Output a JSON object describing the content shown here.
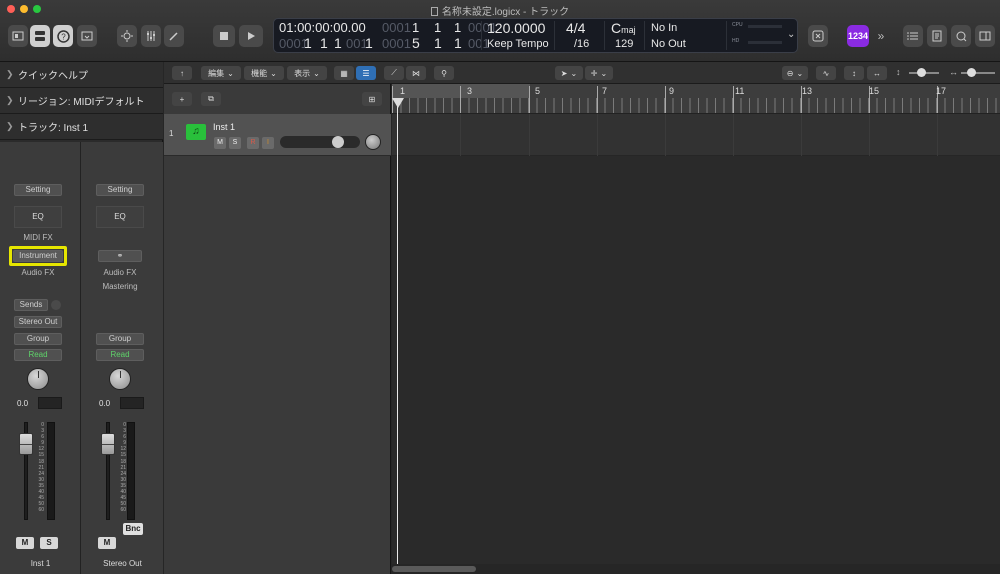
{
  "window": {
    "title": "名称未設定.logicx - トラック"
  },
  "lcd": {
    "position_time": "01:00:00:00.00",
    "position_time_dim": "0001",
    "position_bars": [
      "1",
      "1",
      "1"
    ],
    "position_bars_dim": [
      "0001"
    ],
    "position_bars2": [
      "1",
      "1",
      "1"
    ],
    "end_bars": [
      "5",
      "1",
      "1"
    ],
    "end_bars_dim": [
      "0001",
      "001"
    ],
    "tempo": "120.0000",
    "tempo_mode": "Keep Tempo",
    "signature_top": "4/4",
    "signature_bottom": "/16",
    "key": "C",
    "key_mode": "maj",
    "key_value": "129",
    "midi_in": "No In",
    "midi_out": "No Out",
    "cpu_label": "CPU",
    "hd_label": "HD"
  },
  "toolbar": {
    "count_in_badge": "1234"
  },
  "inspector": {
    "rows": [
      {
        "label": "クイックヘルプ"
      },
      {
        "label": "リージョン: MIDIデフォルト"
      },
      {
        "label": "トラック: Inst 1"
      }
    ],
    "strip1": {
      "setting": "Setting",
      "eq": "EQ",
      "midi_fx": "MIDI FX",
      "instrument": "Instrument",
      "audio_fx": "Audio FX",
      "sends": "Sends",
      "output": "Stereo Out",
      "group": "Group",
      "automation": "Read",
      "volume": "0.0",
      "mute": "M",
      "solo": "S",
      "name": "Inst 1"
    },
    "strip2": {
      "setting": "Setting",
      "eq": "EQ",
      "audio_fx": "Audio FX",
      "mastering": "Mastering",
      "group": "Group",
      "automation": "Read",
      "volume": "0.0",
      "bounce": "Bnc",
      "mute": "M",
      "name": "Stereo Out"
    },
    "scale": [
      "0",
      "3",
      "6",
      "9",
      "12",
      "15",
      "18",
      "21",
      "24",
      "30",
      "35",
      "40",
      "45",
      "50",
      "60"
    ]
  },
  "main_toolbar": {
    "edit": "編集",
    "functions": "機能",
    "view": "表示"
  },
  "track": {
    "number": "1",
    "name": "Inst 1",
    "mute": "M",
    "solo": "S",
    "record": "R",
    "input": "I"
  },
  "ruler": {
    "bars": [
      "1",
      "3",
      "5",
      "7",
      "9",
      "11",
      "13",
      "15",
      "17"
    ]
  }
}
